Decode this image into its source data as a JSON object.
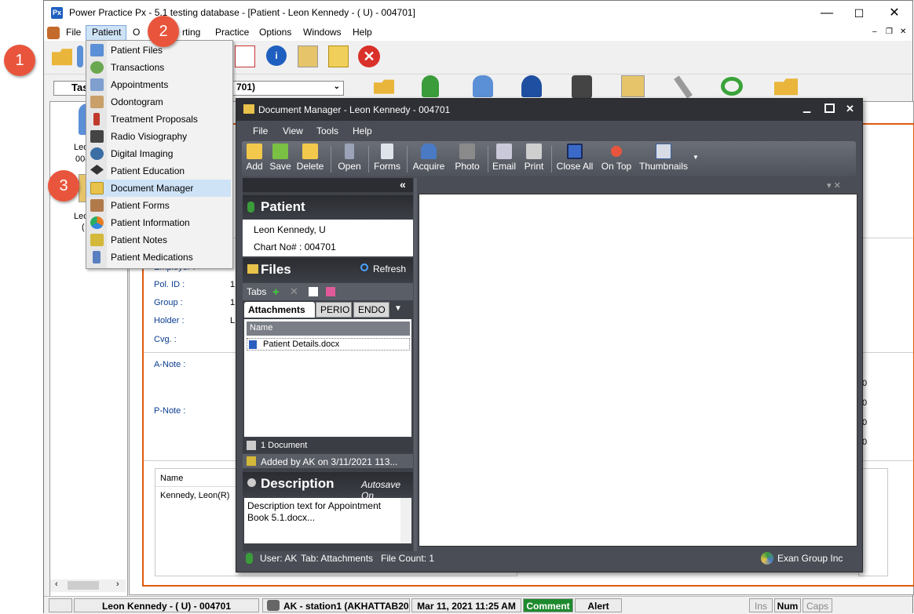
{
  "window": {
    "title": "Power Practice Px - 5.1 testing database - [Patient - Leon Kennedy - ( U) - 004701]",
    "logo": "Px",
    "controls": {
      "minimize": "—",
      "maximize": "☐",
      "close": "✕"
    },
    "mdi_controls": {
      "minimize": "–",
      "restore": "❐",
      "close": "✕"
    }
  },
  "menubar": {
    "items": [
      "File",
      "Patient",
      "Office",
      "Charting",
      "Practice",
      "Options",
      "Windows",
      "Help"
    ],
    "office_partial": "O",
    "charting_partial": "rting"
  },
  "patient_selector": {
    "tab_partial": "Tas",
    "value_partial": "701)"
  },
  "patient_menu": {
    "items": [
      {
        "label": "Patient Files",
        "icon": "patient-files-icon",
        "color": "#5b8fd6"
      },
      {
        "label": "Transactions",
        "icon": "transactions-icon",
        "color": "#6aa84f"
      },
      {
        "label": "Appointments",
        "icon": "appointments-icon",
        "color": "#7f9fcf"
      },
      {
        "label": "Odontogram",
        "icon": "odontogram-icon",
        "color": "#c9a06a"
      },
      {
        "label": "Treatment Proposals",
        "icon": "treatment-proposals-icon",
        "color": "#c0392b"
      },
      {
        "label": "Radio Visiography",
        "icon": "radio-visiography-icon",
        "color": "#444444"
      },
      {
        "label": "Digital Imaging",
        "icon": "digital-imaging-icon",
        "color": "#3a6ea5"
      },
      {
        "label": "Patient Education",
        "icon": "patient-education-icon",
        "color": "#333333"
      },
      {
        "label": "Document Manager",
        "icon": "document-manager-icon",
        "color": "#e8c24a"
      },
      {
        "label": "Patient Forms",
        "icon": "patient-forms-icon",
        "color": "#b07a4a"
      },
      {
        "label": "Patient Information",
        "icon": "patient-information-icon",
        "color": "#e67e22"
      },
      {
        "label": "Patient Notes",
        "icon": "patient-notes-icon",
        "color": "#d4b83a"
      },
      {
        "label": "Patient Medications",
        "icon": "patient-medications-icon",
        "color": "#5a7fc0"
      }
    ]
  },
  "callouts": [
    "1",
    "2",
    "3"
  ],
  "left_panel": {
    "line1": "Leo",
    "line2": "004",
    "line3": "Leo",
    "line4": "("
  },
  "insurance": {
    "employer": "Employer :",
    "pol_id": "Pol. ID :",
    "group": "Group :",
    "holder": "Holder :",
    "cvg": "Cvg. :",
    "a_note": "A-Note :",
    "p_note": "P-Note :",
    "val1": "1",
    "val2": "1",
    "val3": "L",
    "right_vals": [
      "0",
      "0",
      "0",
      "0"
    ]
  },
  "bottom_grid": {
    "header": "Name",
    "row": "Kennedy, Leon(R)"
  },
  "doc_manager": {
    "title": "Document Manager - Leon Kennedy - 004701",
    "menu": [
      "File",
      "View",
      "Tools",
      "Help"
    ],
    "toolbar": [
      {
        "label": "Add",
        "icon": "add-folder-icon",
        "color": "#f2c94c"
      },
      {
        "label": "Save",
        "icon": "save-icon",
        "color": "#7ac143"
      },
      {
        "label": "Delete",
        "icon": "delete-icon",
        "color": "#f2c94c"
      },
      {
        "label": "Open",
        "icon": "open-icon",
        "color": "#9aa3b8"
      },
      {
        "label": "Forms",
        "icon": "forms-icon",
        "color": "#dfe3ea"
      },
      {
        "label": "Acquire",
        "icon": "acquire-icon",
        "color": "#4a7ac4"
      },
      {
        "label": "Photo",
        "icon": "photo-icon",
        "color": "#8a8a8a"
      },
      {
        "label": "Email",
        "icon": "email-icon",
        "color": "#c9c9d9"
      },
      {
        "label": "Print",
        "icon": "print-icon",
        "color": "#cfcfcf"
      },
      {
        "label": "Close All",
        "icon": "close-all-icon",
        "color": "#3a6ac8"
      },
      {
        "label": "On Top",
        "icon": "on-top-icon",
        "color": "#e8553c"
      },
      {
        "label": "Thumbnails",
        "icon": "thumbnails-icon",
        "color": "#d6dbe6"
      }
    ],
    "collapse": "«",
    "patient_header": "Patient",
    "patient_name": "Leon Kennedy,  U",
    "chart_no": "Chart No# : 004701",
    "files_header": "Files",
    "refresh": "Refresh",
    "tabs_label": "Tabs",
    "doc_tabs": [
      "Attachments",
      "PERIO",
      "ENDO"
    ],
    "list_header": "Name",
    "file": "Patient Details.docx",
    "doc_count": "1 Document",
    "added_by": "Added by AK on 3/11/2021 113...",
    "description_header": "Description",
    "autosave": "Autosave On",
    "description_text": "Description text for Appointment Book 5.1.docx...",
    "status_user": "User: AK",
    "status_tab": "Tab:  Attachments",
    "status_count": "File Count:  1",
    "status_company": "Exan Group Inc"
  },
  "statusbar": {
    "patient": "Leon Kennedy - ( U) - 004701",
    "station": "AK - station1 (AKHATTAB20",
    "datetime": "Mar 11, 2021 11:25 AM",
    "comment": "Comment",
    "alert": "Alert",
    "ins": "Ins",
    "num": "Num",
    "caps": "Caps"
  },
  "colors": {
    "accent_orange": "#e05a10",
    "callout": "#e8553c",
    "comment_green": "#1e8a2e"
  }
}
